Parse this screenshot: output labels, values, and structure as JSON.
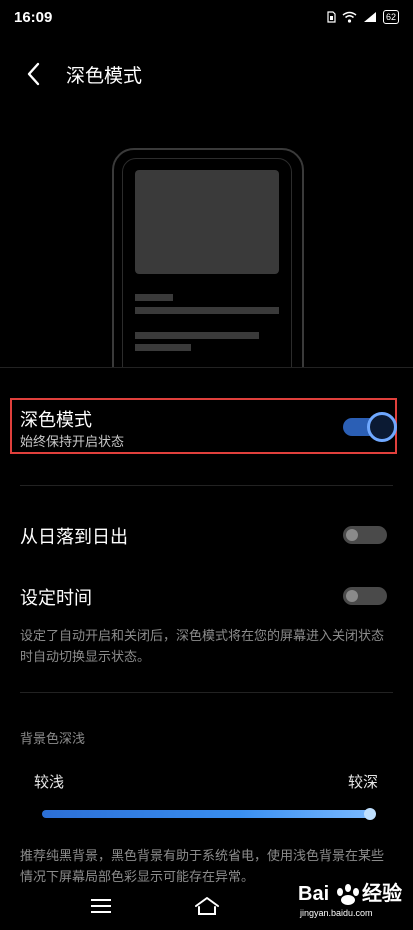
{
  "status_bar": {
    "time": "16:09",
    "battery": "62"
  },
  "header": {
    "title": "深色模式"
  },
  "dark_mode": {
    "title": "深色模式",
    "subtitle": "始终保持开启状态",
    "enabled": true
  },
  "sunset_option": {
    "label": "从日落到日出",
    "enabled": false
  },
  "schedule_option": {
    "label": "设定时间",
    "enabled": false
  },
  "description": "设定了自动开启和关闭后，深色模式将在您的屏幕进入关闭状态时自动切换显示状态。",
  "background_depth": {
    "section_label": "背景色深浅",
    "min_label": "较浅",
    "max_label": "较深",
    "value": 1.0,
    "note": "推荐纯黑背景，黑色背景有助于系统省电，使用浅色背景在某些情况下屏幕局部色彩显示可能存在异常。"
  },
  "watermark": {
    "brand": "Bai du 经验",
    "url": "jingyan.baidu.com"
  },
  "colors": {
    "accent": "#2b5fb5",
    "toggle_knob_ring": "#6fa8ff",
    "highlight_border": "#e0403c"
  }
}
